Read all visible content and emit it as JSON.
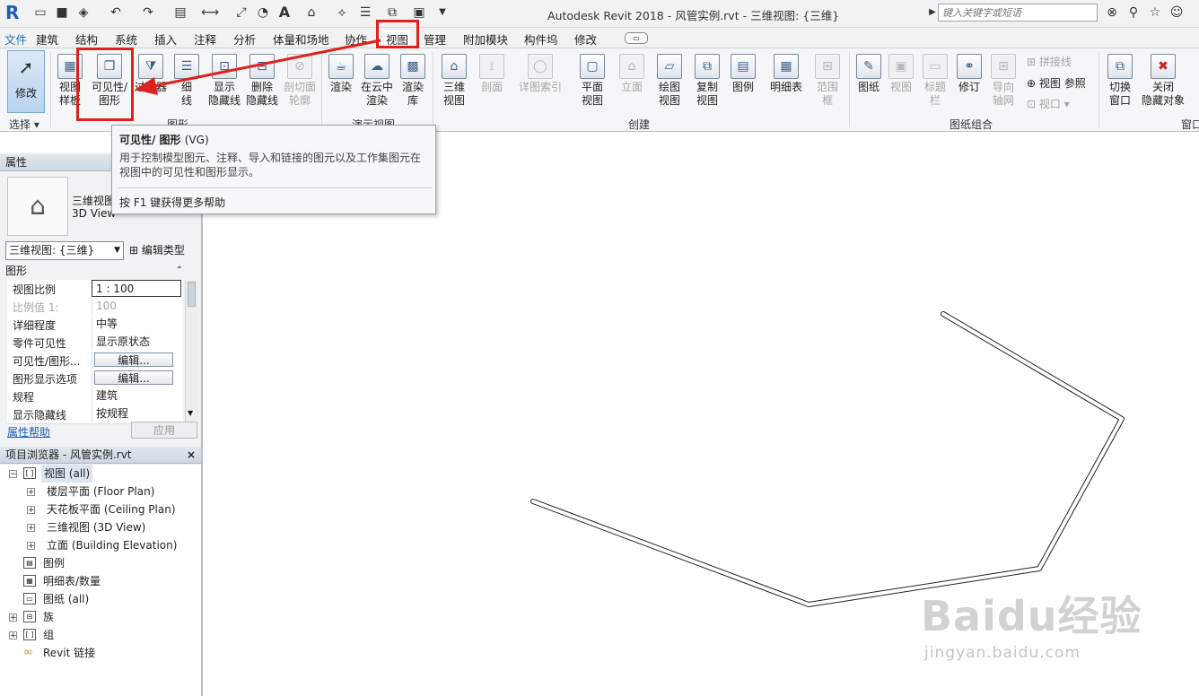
{
  "app": {
    "logo": "R",
    "title": "Autodesk Revit 2018 -     风管实例.rvt - 三维视图: {三维}",
    "search_placeholder": "键入关键字或短语"
  },
  "quick_access": {
    "icons": [
      "open-icon",
      "save-icon",
      "sync-icon",
      "undo-icon",
      "redo-icon",
      "print-icon",
      "measure-icon",
      "dimension-icon",
      "tag-icon",
      "text-icon",
      "3d-icon",
      "section-icon",
      "thin-lines-icon",
      "switch-windows-icon",
      "customize-icon"
    ],
    "text_tool": "A"
  },
  "menu_tabs": [
    "文件",
    "建筑",
    "结构",
    "系统",
    "插入",
    "注释",
    "分析",
    "体量和场地",
    "协作",
    "视图",
    "管理",
    "附加模块",
    "构件坞",
    "修改"
  ],
  "active_tab": "视图",
  "ribbon": {
    "select": {
      "label": "修改",
      "group": "选择"
    },
    "graphics_buttons": [
      {
        "label": "视图\n样板",
        "icon": "view-template-icon"
      },
      {
        "label": "可见性/\n图形",
        "icon": "visibility-graphics-icon"
      },
      {
        "label": "过滤器",
        "icon": "filters-icon"
      },
      {
        "label": "细\n线",
        "icon": "thin-lines-icon"
      },
      {
        "label": "显示\n隐藏线",
        "icon": "show-hidden-lines-icon"
      },
      {
        "label": "删除\n隐藏线",
        "icon": "remove-hidden-lines-icon"
      },
      {
        "label": "剖切面\n轮廓",
        "icon": "cut-profile-icon"
      }
    ],
    "graphics_group": "图形",
    "presentation_buttons": [
      {
        "label": "渲染",
        "icon": "render-icon"
      },
      {
        "label": "在云中\n渲染",
        "icon": "cloud-render-icon"
      },
      {
        "label": "渲染\n库",
        "icon": "render-gallery-icon"
      }
    ],
    "presentation_group": "演示视图",
    "create_buttons": [
      {
        "label": "三维\n视图",
        "icon": "3d-view-icon"
      },
      {
        "label": "剖面",
        "icon": "section-icon"
      },
      {
        "label": "详图索引",
        "icon": "callout-icon"
      },
      {
        "label": "平面\n视图",
        "icon": "plan-views-icon"
      },
      {
        "label": "立面",
        "icon": "elevation-icon"
      },
      {
        "label": "绘图\n视图",
        "icon": "drafting-view-icon"
      },
      {
        "label": "复制\n视图",
        "icon": "duplicate-view-icon"
      },
      {
        "label": "图例",
        "icon": "legends-icon"
      },
      {
        "label": "明细表",
        "icon": "schedules-icon"
      },
      {
        "label": "范围\n框",
        "icon": "scope-box-icon"
      }
    ],
    "create_group": "创建",
    "sheet_buttons": [
      {
        "label": "图纸",
        "icon": "sheet-icon"
      },
      {
        "label": "视图",
        "icon": "place-view-icon"
      },
      {
        "label": "标题\n栏",
        "icon": "title-block-icon"
      },
      {
        "label": "修订",
        "icon": "revisions-icon"
      },
      {
        "label": "导向\n轴网",
        "icon": "guide-grid-icon"
      }
    ],
    "sheet_small": [
      "拼接线",
      "视图 参照",
      "视口"
    ],
    "sheet_group": "图纸组合",
    "window_buttons": [
      {
        "label": "切换\n窗口",
        "icon": "switch-windows-icon"
      },
      {
        "label": "关闭\n隐藏对象",
        "icon": "close-hidden-icon"
      }
    ],
    "window_group": "窗口"
  },
  "tooltip": {
    "title": "可见性/ 图形",
    "shortcut": "(VG)",
    "description": "用于控制模型图元、注释、导入和链接的图元以及工作集图元在视图中的可见性和图形显示。",
    "help": "按 F1 键获得更多帮助"
  },
  "properties": {
    "header": "属性",
    "type_name": "三维视图",
    "type_subname": "3D View",
    "selector": "三维视图: {三维}",
    "edit_type": "编辑类型",
    "section": "图形",
    "rows": [
      {
        "key": "视图比例",
        "value": "1 : 100",
        "kind": "input"
      },
      {
        "key": "比例值 1:",
        "value": "100",
        "kind": "dim"
      },
      {
        "key": "详细程度",
        "value": "中等",
        "kind": "text"
      },
      {
        "key": "零件可见性",
        "value": "显示原状态",
        "kind": "text"
      },
      {
        "key": "可见性/图形...",
        "value": "编辑...",
        "kind": "button"
      },
      {
        "key": "图形显示选项",
        "value": "编辑...",
        "kind": "button"
      },
      {
        "key": "规程",
        "value": "建筑",
        "kind": "text"
      },
      {
        "key": "显示隐藏线",
        "value": "按规程",
        "kind": "text"
      }
    ],
    "help_link": "属性帮助",
    "apply": "应用"
  },
  "browser": {
    "header": "项目浏览器 - 风管实例.rvt",
    "items": [
      {
        "label": "视图 (all)",
        "level": 0,
        "expander": "−",
        "icon": "views-icon"
      },
      {
        "label": "楼层平面 (Floor Plan)",
        "level": 1,
        "expander": "+"
      },
      {
        "label": "天花板平面 (Ceiling Plan)",
        "level": 1,
        "expander": "+"
      },
      {
        "label": "三维视图 (3D View)",
        "level": 1,
        "expander": "+"
      },
      {
        "label": "立面 (Building Elevation)",
        "level": 1,
        "expander": "+"
      },
      {
        "label": "图例",
        "level": 0,
        "expander": "",
        "icon": "legends-icon"
      },
      {
        "label": "明细表/数量",
        "level": 0,
        "expander": "",
        "icon": "schedules-icon"
      },
      {
        "label": "图纸 (all)",
        "level": 0,
        "expander": "",
        "icon": "sheets-icon"
      },
      {
        "label": "族",
        "level": 0,
        "expander": "+",
        "icon": "families-icon"
      },
      {
        "label": "组",
        "level": 0,
        "expander": "+",
        "icon": "groups-icon"
      },
      {
        "label": "Revit 链接",
        "level": 0,
        "expander": "",
        "icon": "revit-links-icon"
      }
    ]
  },
  "watermark": {
    "brand": "Baidu经验",
    "url": "jingyan.baidu.com"
  }
}
